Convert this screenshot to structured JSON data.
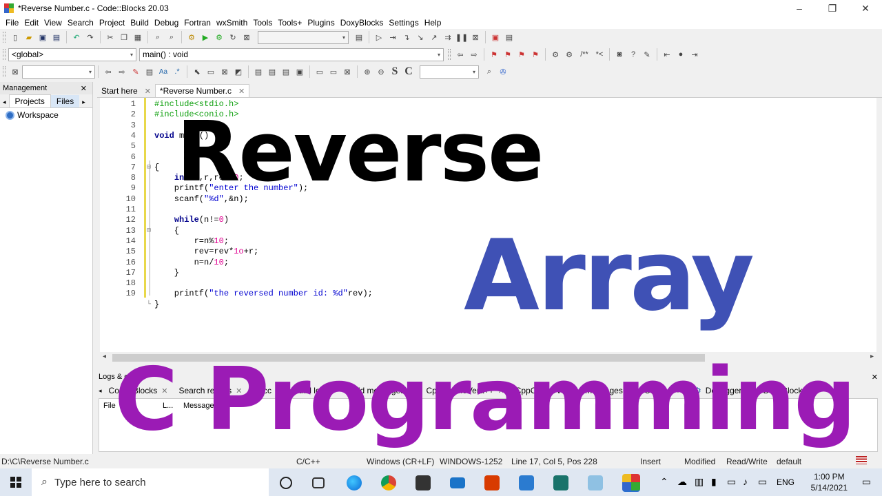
{
  "window": {
    "title": "*Reverse Number.c - Code::Blocks 20.03",
    "controls": [
      "–",
      "❐",
      "✕"
    ]
  },
  "menu": [
    "File",
    "Edit",
    "View",
    "Search",
    "Project",
    "Build",
    "Debug",
    "Fortran",
    "wxSmith",
    "Tools",
    "Tools+",
    "Plugins",
    "DoxyBlocks",
    "Settings",
    "Help"
  ],
  "toolbar2": {
    "scope": "<global>",
    "function": "main() : void"
  },
  "toolbar3": {
    "search_value": "",
    "text_S": "S",
    "text_C": "C"
  },
  "management": {
    "title": "Management",
    "tabs": [
      "Projects",
      "Files"
    ],
    "workspace": "Workspace"
  },
  "editor_tabs": [
    {
      "label": "Start here"
    },
    {
      "label": "*Reverse Number.c"
    }
  ],
  "code": [
    {
      "n": "1",
      "fold": "",
      "parts": [
        {
          "c": "pp",
          "t": "#include<stdio.h>"
        }
      ]
    },
    {
      "n": "2",
      "fold": "",
      "parts": [
        {
          "c": "pp",
          "t": "#include<conio.h>"
        }
      ]
    },
    {
      "n": "3",
      "fold": "",
      "parts": []
    },
    {
      "n": "4",
      "fold": "",
      "parts": [
        {
          "c": "kw",
          "t": "void"
        },
        {
          "c": "plain",
          "t": " main()"
        }
      ]
    },
    {
      "n": "5",
      "fold": "",
      "parts": []
    },
    {
      "n": "6",
      "fold": "",
      "parts": []
    },
    {
      "n": "7",
      "fold": "⊟",
      "parts": [
        {
          "c": "plain",
          "t": "{"
        }
      ]
    },
    {
      "n": "8",
      "fold": "",
      "parts": [
        {
          "c": "plain",
          "t": "    "
        },
        {
          "c": "kw",
          "t": "int"
        },
        {
          "c": "plain",
          "t": " n,r,rev="
        },
        {
          "c": "num",
          "t": "0"
        },
        {
          "c": "plain",
          "t": ";"
        }
      ]
    },
    {
      "n": "9",
      "fold": "",
      "parts": [
        {
          "c": "plain",
          "t": "    printf("
        },
        {
          "c": "str",
          "t": "\"enter the number\""
        },
        {
          "c": "plain",
          "t": ");"
        }
      ]
    },
    {
      "n": "10",
      "fold": "",
      "parts": [
        {
          "c": "plain",
          "t": "    scanf("
        },
        {
          "c": "str",
          "t": "\"%d\""
        },
        {
          "c": "plain",
          "t": ",&n);"
        }
      ]
    },
    {
      "n": "11",
      "fold": "",
      "parts": []
    },
    {
      "n": "12",
      "fold": "",
      "parts": [
        {
          "c": "plain",
          "t": "    "
        },
        {
          "c": "kw",
          "t": "while"
        },
        {
          "c": "plain",
          "t": "(n!="
        },
        {
          "c": "num",
          "t": "0"
        },
        {
          "c": "plain",
          "t": ")"
        }
      ]
    },
    {
      "n": "13",
      "fold": "⊟",
      "parts": [
        {
          "c": "plain",
          "t": "    {"
        }
      ]
    },
    {
      "n": "14",
      "fold": "",
      "parts": [
        {
          "c": "plain",
          "t": "        r=n%"
        },
        {
          "c": "num",
          "t": "10"
        },
        {
          "c": "plain",
          "t": ";"
        }
      ]
    },
    {
      "n": "15",
      "fold": "",
      "parts": [
        {
          "c": "plain",
          "t": "        rev=rev*"
        },
        {
          "c": "num",
          "t": "1o"
        },
        {
          "c": "plain",
          "t": "+r;"
        }
      ]
    },
    {
      "n": "16",
      "fold": "",
      "parts": [
        {
          "c": "plain",
          "t": "        n=n/"
        },
        {
          "c": "num",
          "t": "10"
        },
        {
          "c": "plain",
          "t": ";"
        }
      ]
    },
    {
      "n": "17",
      "fold": "",
      "parts": [
        {
          "c": "plain",
          "t": "    }"
        }
      ]
    },
    {
      "n": "18",
      "fold": "",
      "parts": []
    },
    {
      "n": "19",
      "fold": "",
      "parts": [
        {
          "c": "plain",
          "t": "    printf("
        },
        {
          "c": "str",
          "t": "\"the reversed number id: %d\""
        },
        {
          "c": "plain",
          "t": "rev);"
        }
      ]
    },
    {
      "n": "",
      "fold": "└",
      "parts": [
        {
          "c": "plain",
          "t": "}"
        }
      ]
    }
  ],
  "logs": {
    "title": "Logs & others",
    "tabs": [
      "Code::Blocks",
      "Search results",
      "Cccc",
      "Build log",
      "Build messages",
      "CppCheck/Vera++",
      "CppCheck/Vera++ messages",
      "Cscope",
      "Debugger",
      "DoxyBlocks"
    ],
    "columns": [
      "File",
      "L...",
      "Message"
    ]
  },
  "status": {
    "path": "D:\\C\\Reverse Number.c",
    "lang": "C/C++",
    "eol": "Windows (CR+LF)",
    "encoding": "WINDOWS-1252",
    "position": "Line 17, Col 5, Pos 228",
    "mode": "Insert",
    "modified": "Modified",
    "rw": "Read/Write",
    "profile": "default"
  },
  "taskbar": {
    "search_placeholder": "Type here to search",
    "lang": "ENG",
    "time": "1:00 PM",
    "date": "5/14/2021"
  },
  "overlay": {
    "line1": "Reverse",
    "line2": "Array",
    "line3": "C Programming"
  },
  "colors": {
    "overlay_blue": "#3f51b5",
    "overlay_purple": "#9b1bb5",
    "preprocessor": "#0fa00f",
    "keyword": "#00008b",
    "string": "#0000d0",
    "number": "#e00090"
  }
}
